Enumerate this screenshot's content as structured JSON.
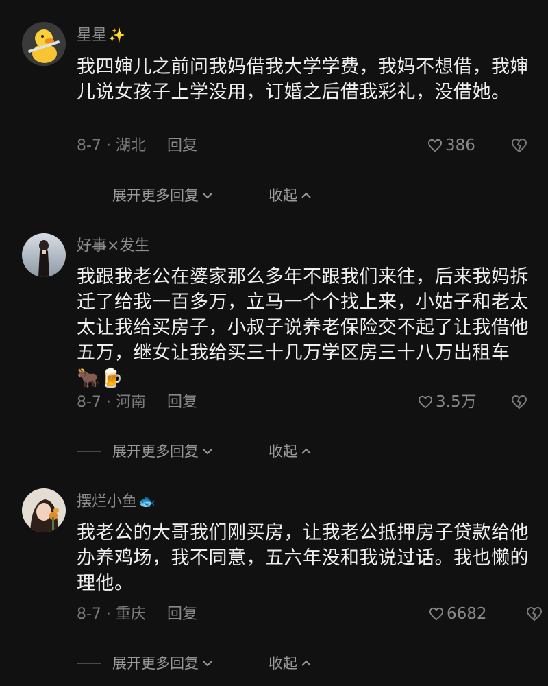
{
  "comments": [
    {
      "username": "星星",
      "username_emoji": "✨",
      "avatar": "duck-avatar",
      "text": "我四婶儿之前问我妈借我大学学费，我妈不想借，我婶儿说女孩子上学没用，订婚之后借我彩礼，没借她。",
      "date": "8-7",
      "location": "湖北",
      "reply_label": "回复",
      "likes": "386",
      "expand_label": "展开更多回复",
      "collapse_label": "收起"
    },
    {
      "username": "好事×发生",
      "username_emoji": "",
      "avatar": "woman-dark-dress-avatar",
      "text": "我跟我老公在婆家那么多年不跟我们来往，后来我妈拆迁了给我一百多万，立马一个个找上来，小姑子和老太太让我给买房子，小叔子说养老保险交不起了让我借他五万，继女让我给买三十几万学区房三十八万出租车🐂🍺",
      "date": "8-7",
      "location": "河南",
      "reply_label": "回复",
      "likes": "3.5万",
      "expand_label": "展开更多回复",
      "collapse_label": "收起"
    },
    {
      "username": "摆烂小鱼",
      "username_emoji": "🐟",
      "avatar": "girl-with-flowers-avatar",
      "text": "我老公的大哥我们刚买房，让我老公抵押房子贷款给他办养鸡场，我不同意，五六年没和我说过话。我也懒的理他。",
      "date": "8-7",
      "location": "重庆",
      "reply_label": "回复",
      "likes": "6682",
      "expand_label": "展开更多回复",
      "collapse_label": "收起"
    }
  ],
  "meta_separator": "·",
  "colors": {
    "background": "#111111",
    "text_primary": "#efefef",
    "text_secondary": "#8f8f8f"
  }
}
